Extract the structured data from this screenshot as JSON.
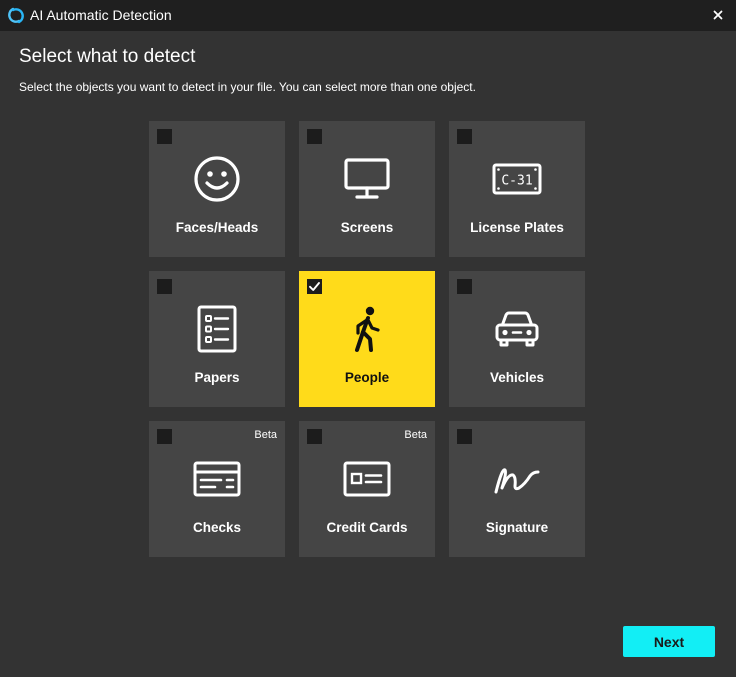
{
  "window": {
    "title": "AI Automatic Detection",
    "close_symbol": "×"
  },
  "header": {
    "title": "Select what to detect",
    "subtitle": "Select the objects you want to detect in your file. You can select more than one object."
  },
  "options": [
    {
      "label": "Faces/Heads",
      "icon": "face-icon",
      "selected": false,
      "badge": ""
    },
    {
      "label": "Screens",
      "icon": "monitor-icon",
      "selected": false,
      "badge": ""
    },
    {
      "label": "License Plates",
      "icon": "license-plate-icon",
      "selected": false,
      "badge": "",
      "plate_text": "C-31"
    },
    {
      "label": "Papers",
      "icon": "document-list-icon",
      "selected": false,
      "badge": ""
    },
    {
      "label": "People",
      "icon": "walking-person-icon",
      "selected": true,
      "badge": ""
    },
    {
      "label": "Vehicles",
      "icon": "car-icon",
      "selected": false,
      "badge": ""
    },
    {
      "label": "Checks",
      "icon": "check-icon",
      "selected": false,
      "badge": "Beta"
    },
    {
      "label": "Credit Cards",
      "icon": "credit-card-icon",
      "selected": false,
      "badge": "Beta"
    },
    {
      "label": "Signature",
      "icon": "signature-icon",
      "selected": false,
      "badge": ""
    }
  ],
  "footer": {
    "next_label": "Next"
  },
  "colors": {
    "background": "#333333",
    "titlebar": "#1f1f1f",
    "tile": "#454545",
    "tile_selected": "#ffdb1a",
    "accent_button": "#12eef5"
  }
}
